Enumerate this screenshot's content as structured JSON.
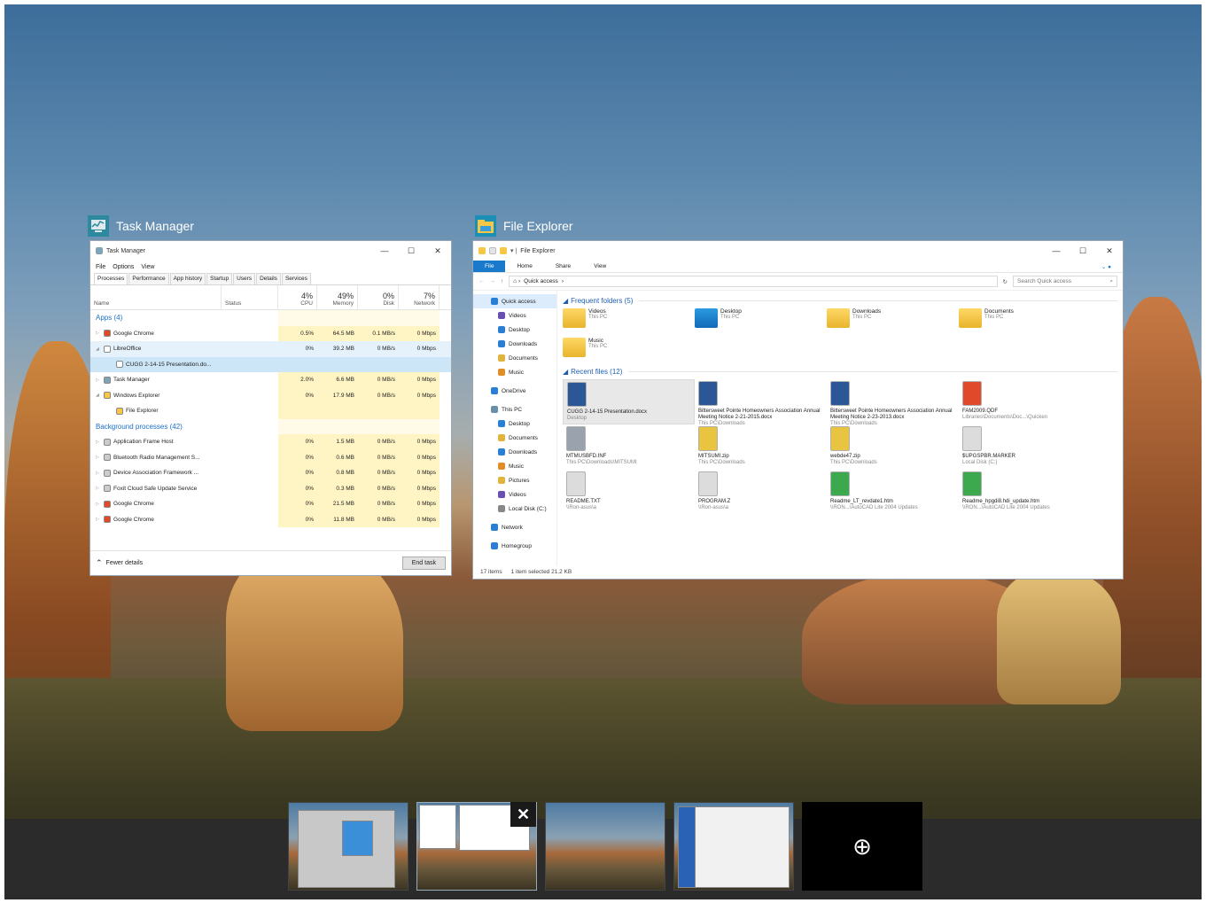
{
  "task_manager": {
    "label": "Task Manager",
    "title": "Task Manager",
    "menu": [
      "File",
      "Options",
      "View"
    ],
    "tabs": [
      "Processes",
      "Performance",
      "App history",
      "Startup",
      "Users",
      "Details",
      "Services"
    ],
    "columns": {
      "name": "Name",
      "status": "Status",
      "cpu_pct": "4%",
      "cpu": "CPU",
      "mem_pct": "49%",
      "mem": "Memory",
      "disk_pct": "0%",
      "disk": "Disk",
      "net_pct": "7%",
      "net": "Network"
    },
    "rows": [
      {
        "name": "Apps (4)",
        "group": true
      },
      {
        "name": "Google Chrome",
        "cpu": "0.5%",
        "mem": "64.5 MB",
        "disk": "0.1 MB/s",
        "net": "0 Mbps"
      },
      {
        "name": "LibreOffice",
        "cpu": "0%",
        "mem": "39.2 MB",
        "disk": "0 MB/s",
        "net": "0 Mbps"
      },
      {
        "name": "CUGG 2-14-15 Presentation.do...",
        "cpu": "",
        "mem": "",
        "disk": "",
        "net": ""
      },
      {
        "name": "Task Manager",
        "cpu": "2.0%",
        "mem": "6.6 MB",
        "disk": "0 MB/s",
        "net": "0 Mbps"
      },
      {
        "name": "Windows Explorer",
        "cpu": "0%",
        "mem": "17.9 MB",
        "disk": "0 MB/s",
        "net": "0 Mbps"
      },
      {
        "name": "File Explorer",
        "cpu": "",
        "mem": "",
        "disk": "",
        "net": ""
      },
      {
        "name": "Background processes (42)",
        "group": true
      },
      {
        "name": "Application Frame Host",
        "cpu": "0%",
        "mem": "1.5 MB",
        "disk": "0 MB/s",
        "net": "0 Mbps"
      },
      {
        "name": "Bluetooth Radio Management S...",
        "cpu": "0%",
        "mem": "0.6 MB",
        "disk": "0 MB/s",
        "net": "0 Mbps"
      },
      {
        "name": "Device Association Framework ...",
        "cpu": "0%",
        "mem": "0.8 MB",
        "disk": "0 MB/s",
        "net": "0 Mbps"
      },
      {
        "name": "Foxit Cloud Safe Update Service",
        "cpu": "0%",
        "mem": "0.3 MB",
        "disk": "0 MB/s",
        "net": "0 Mbps"
      },
      {
        "name": "Google Chrome",
        "cpu": "0%",
        "mem": "21.5 MB",
        "disk": "0 MB/s",
        "net": "0 Mbps"
      },
      {
        "name": "Google Chrome",
        "cpu": "0%",
        "mem": "11.8 MB",
        "disk": "0 MB/s",
        "net": "0 Mbps"
      }
    ],
    "fewer_details": "Fewer details",
    "end_task": "End task"
  },
  "file_explorer": {
    "label": "File Explorer",
    "title": "File Explorer",
    "ribbon": [
      "File",
      "Home",
      "Share",
      "View"
    ],
    "address": "Quick access",
    "search_placeholder": "Search Quick access",
    "nav": [
      {
        "label": "Quick access",
        "level": "top",
        "selected": true
      },
      {
        "label": "Videos"
      },
      {
        "label": "Desktop"
      },
      {
        "label": "Downloads"
      },
      {
        "label": "Documents"
      },
      {
        "label": "Music"
      },
      {
        "label": "OneDrive",
        "level": "top"
      },
      {
        "label": "This PC",
        "level": "top"
      },
      {
        "label": "Desktop"
      },
      {
        "label": "Documents"
      },
      {
        "label": "Downloads"
      },
      {
        "label": "Music"
      },
      {
        "label": "Pictures"
      },
      {
        "label": "Videos"
      },
      {
        "label": "Local Disk (C:)"
      },
      {
        "label": "Network",
        "level": "top"
      },
      {
        "label": "Homegroup",
        "level": "top"
      }
    ],
    "frequent_header": "Frequent folders (5)",
    "frequent": [
      {
        "name": "Videos",
        "sub": "This PC"
      },
      {
        "name": "Desktop",
        "sub": "This PC"
      },
      {
        "name": "Downloads",
        "sub": "This PC"
      },
      {
        "name": "Documents",
        "sub": "This PC"
      },
      {
        "name": "Music",
        "sub": "This PC"
      }
    ],
    "recent_header": "Recent files (12)",
    "recent": [
      {
        "name": "CUGG 2-14-15 Presentation.docx",
        "sub": "Desktop",
        "color": "#2b5797"
      },
      {
        "name": "Bittersweet Pointe Homeowners Association Annual Meeting Notice 2-21-2015.docx",
        "sub": "This PC\\Downloads",
        "color": "#2b5797"
      },
      {
        "name": "Bittersweet Pointe Homeowners Association Annual Meeting Notice 2-23-2013.docx",
        "sub": "This PC\\Downloads",
        "color": "#2b5797"
      },
      {
        "name": "FAM2009.QDF",
        "sub": "Libraries\\Documents\\Doc...\\Quicken",
        "color": "#e04a2a"
      },
      {
        "name": "MTMUSBFD.INF",
        "sub": "This PC\\Downloads\\MITSUMI",
        "color": "#9aa3ad"
      },
      {
        "name": "MITSUMI.zip",
        "sub": "This PC\\Downloads",
        "color": "#e8c440"
      },
      {
        "name": "webde47.zip",
        "sub": "This PC\\Downloads",
        "color": "#e8c440"
      },
      {
        "name": "$UPGSPBR.MARKER",
        "sub": "Local Disk (C:)",
        "color": "#dcdcdc"
      },
      {
        "name": "README.TXT",
        "sub": "\\\\Ron-asus\\a",
        "color": "#dcdcdc"
      },
      {
        "name": "PROGRAM.Z",
        "sub": "\\\\Ron-asus\\a",
        "color": "#dcdcdc"
      },
      {
        "name": "Readme_LT_revdate1.htm",
        "sub": "\\\\RON...\\AutoCAD Lite 2004 Updates",
        "color": "#3ca94f"
      },
      {
        "name": "Readme_hpgdi8.hdi_update.htm",
        "sub": "\\\\RON...\\AutoCAD Lite 2004 Updates",
        "color": "#3ca94f"
      }
    ],
    "status_items": "17 items",
    "status_selected": "1 item selected  21.2 KB"
  },
  "virtual_desktops": {
    "new_desktop_icon": "plus-circle-icon",
    "new_desktop_glyph": "⊕",
    "close_glyph": "✕"
  }
}
